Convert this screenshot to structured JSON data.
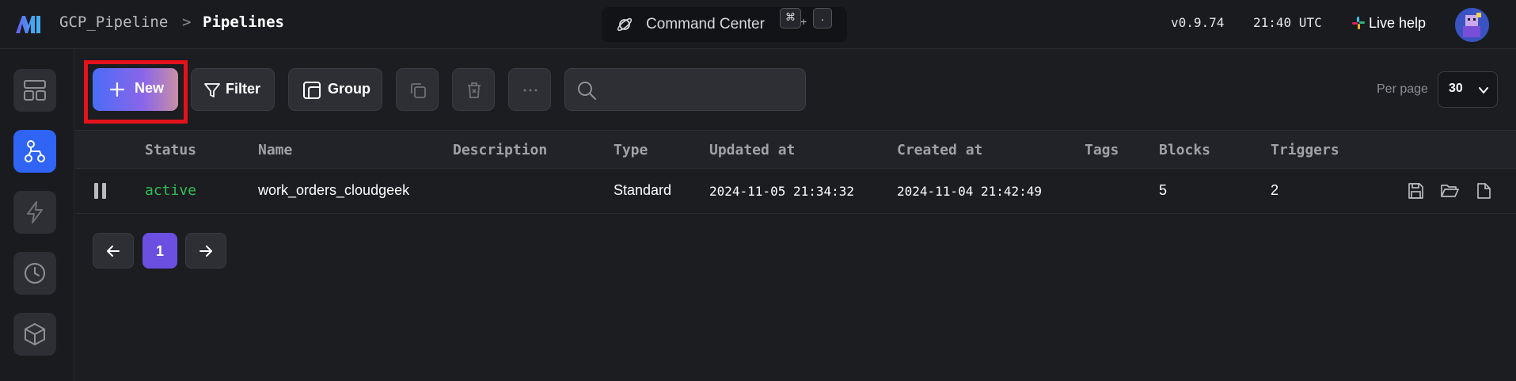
{
  "header": {
    "project": "GCP_Pipeline",
    "separator": ">",
    "page": "Pipelines",
    "command_center": {
      "label": "Command Center",
      "key1": "⌘",
      "plus": "+",
      "key2": "."
    },
    "version": "v0.9.74",
    "time": "21:40 UTC",
    "live_help": "Live help"
  },
  "sidebar": {
    "items": [
      {
        "name": "overview",
        "icon": "layout-icon",
        "active": false
      },
      {
        "name": "pipelines",
        "icon": "pipeline-tree-icon",
        "active": true
      },
      {
        "name": "triggers",
        "icon": "lightning-icon",
        "active": false
      },
      {
        "name": "runs",
        "icon": "clock-icon",
        "active": false
      },
      {
        "name": "blocks",
        "icon": "cube-icon",
        "active": false
      }
    ]
  },
  "toolbar": {
    "new_label": "New",
    "filter_label": "Filter",
    "group_label": "Group",
    "search_placeholder": "",
    "per_page_label": "Per page",
    "per_page_value": "30"
  },
  "table": {
    "columns": [
      "Status",
      "Name",
      "Description",
      "Type",
      "Updated at",
      "Created at",
      "Tags",
      "Blocks",
      "Triggers"
    ],
    "rows": [
      {
        "status": "active",
        "name": "work_orders_cloudgeek",
        "description": "",
        "type": "Standard",
        "updated_at": "2024-11-05 21:34:32",
        "created_at": "2024-11-04 21:42:49",
        "tags": "",
        "blocks": "5",
        "triggers": "2"
      }
    ]
  },
  "pagination": {
    "current_page": "1"
  },
  "colors": {
    "accent": "#2f64f5",
    "status_active": "#2fbf55",
    "pagination_current": "#6b4fe0",
    "highlight": "#e3121b"
  }
}
